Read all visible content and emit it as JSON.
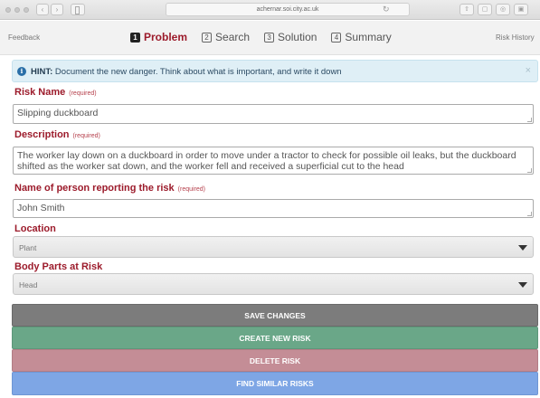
{
  "browser": {
    "url": "achernar.soi.city.ac.uk",
    "back_glyph": "‹",
    "forward_glyph": "›",
    "reload_glyph": "↻"
  },
  "nav": {
    "feedback": "Feedback",
    "risk_history": "Risk History",
    "steps": [
      {
        "num": "1",
        "label": "Problem"
      },
      {
        "num": "2",
        "label": "Search"
      },
      {
        "num": "3",
        "label": "Solution"
      },
      {
        "num": "4",
        "label": "Summary"
      }
    ],
    "active_step": "Problem"
  },
  "hint": {
    "prefix": "HINT:",
    "text": "Document the new danger. Think about what is important, and write it down",
    "close_glyph": "×",
    "info_glyph": "i"
  },
  "form": {
    "risk_name": {
      "label": "Risk Name",
      "required": "(required)",
      "value": "Slipping duckboard"
    },
    "description": {
      "label": "Description",
      "required": "(required)",
      "value": "The worker lay down on a duckboard in order to move under a tractor to check for possible oil leaks, but the duckboard shifted as the worker sat down, and the worker fell and received a superficial cut to the head"
    },
    "reporter": {
      "label": "Name of person reporting the risk",
      "required": "(required)",
      "value": "John Smith"
    },
    "location": {
      "label": "Location",
      "value": "Plant"
    },
    "body_parts": {
      "label": "Body Parts at Risk",
      "value": "Head"
    }
  },
  "buttons": {
    "save": "SAVE CHANGES",
    "create": "CREATE NEW RISK",
    "delete": "DELETE RISK",
    "find": "FIND SIMILAR RISKS"
  },
  "colors": {
    "accent": "#9c1b2b",
    "save": "#7c7c7c",
    "create": "#6aa788",
    "delete": "#c48d96",
    "find": "#7ea6e5",
    "hint_bg": "#dfeff6"
  }
}
